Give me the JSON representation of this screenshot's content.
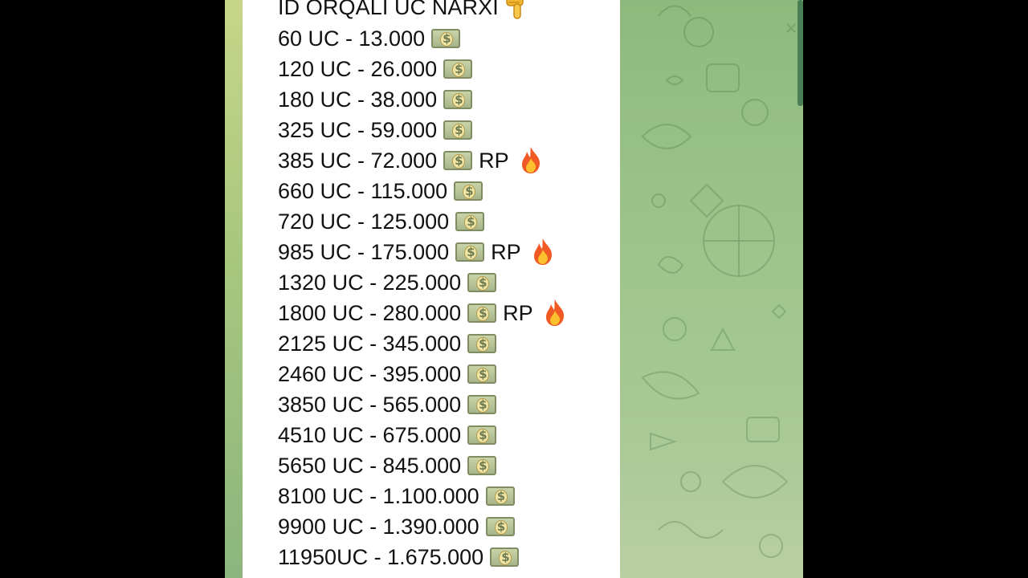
{
  "title": "ID ORQALI UC NARXI",
  "title_icon": "pointing-down-hand-icon",
  "rows": [
    {
      "text": "60 UC  -  13.000",
      "rp": ""
    },
    {
      "text": "120 UC - 26.000",
      "rp": ""
    },
    {
      "text": "180 UC  - 38.000",
      "rp": ""
    },
    {
      "text": "325 UC - 59.000",
      "rp": ""
    },
    {
      "text": "385 UC - 72.000",
      "rp": "RP"
    },
    {
      "text": "660 UC - 115.000",
      "rp": ""
    },
    {
      "text": "720 UC - 125.000",
      "rp": ""
    },
    {
      "text": "985 UC - 175.000",
      "rp": "RP"
    },
    {
      "text": "1320 UC - 225.000",
      "rp": ""
    },
    {
      "text": "1800 UC - 280.000",
      "rp": "RP"
    },
    {
      "text": "2125 UC - 345.000",
      "rp": ""
    },
    {
      "text": "2460 UC - 395.000",
      "rp": ""
    },
    {
      "text": "3850 UC - 565.000",
      "rp": ""
    },
    {
      "text": "4510 UC - 675.000",
      "rp": ""
    },
    {
      "text": "5650 UC - 845.000",
      "rp": ""
    },
    {
      "text": "8100 UC - 1.100.000",
      "rp": ""
    },
    {
      "text": "9900 UC - 1.390.000",
      "rp": ""
    },
    {
      "text": "11950UC -  1.675.000",
      "rp": ""
    }
  ],
  "row_icon": "money-bill-icon",
  "rp_icon": "fire-icon",
  "colors": {
    "chat_background": "#9cc48a",
    "bubble": "#ffffff",
    "text": "#111111"
  }
}
